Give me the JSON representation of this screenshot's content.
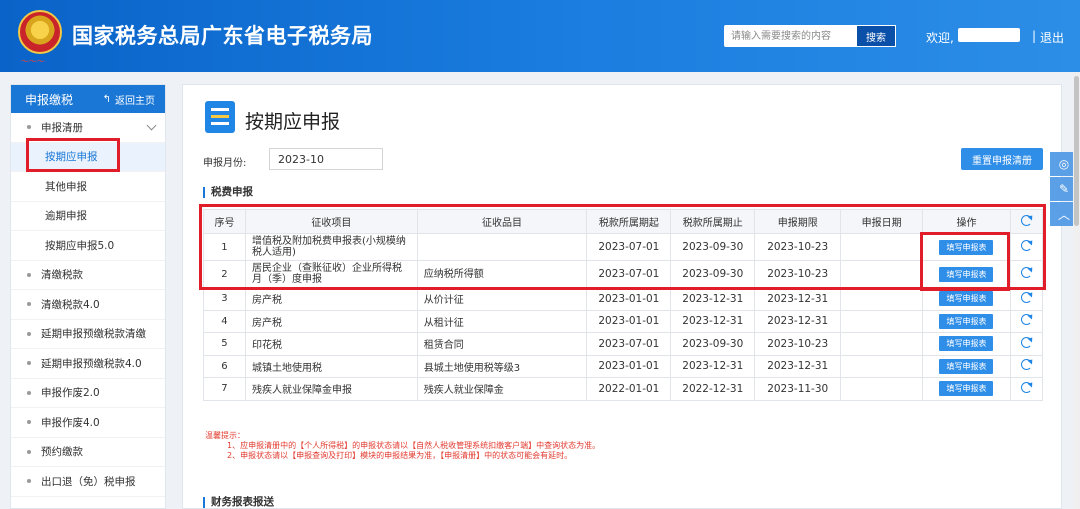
{
  "header": {
    "site_title": "国家税务总局广东省电子税务局",
    "search_placeholder": "请输入需要搜索的内容",
    "search_label": "搜索",
    "welcome": "欢迎,",
    "separator": "|",
    "logout": "退出",
    "brand_color": "#1b7ee0"
  },
  "sidebar": {
    "title": "申报缴税",
    "back_label": "返回主页",
    "items": [
      {
        "label": "申报清册",
        "type": "group"
      },
      {
        "label": "按期应申报",
        "type": "sub",
        "active": true
      },
      {
        "label": "其他申报",
        "type": "sub"
      },
      {
        "label": "逾期申报",
        "type": "sub"
      },
      {
        "label": "按期应申报5.0",
        "type": "sub"
      },
      {
        "label": "清缴税款",
        "type": "item"
      },
      {
        "label": "清缴税款4.0",
        "type": "item"
      },
      {
        "label": "延期申报预缴税款清缴",
        "type": "item"
      },
      {
        "label": "延期申报预缴税款4.0",
        "type": "item"
      },
      {
        "label": "申报作废2.0",
        "type": "item"
      },
      {
        "label": "申报作废4.0",
        "type": "item"
      },
      {
        "label": "预约缴款",
        "type": "item"
      },
      {
        "label": "出口退（免）税申报",
        "type": "item"
      }
    ]
  },
  "main": {
    "page_title": "按期应申报",
    "period_label": "申报月份:",
    "period_value": "2023-10",
    "reset_button": "重置申报清册",
    "section_fees": "税费申报",
    "section_financial": "财务报表报送",
    "table": {
      "headers": [
        "序号",
        "征收项目",
        "征收品目",
        "税款所属期起",
        "税款所属期止",
        "申报期限",
        "申报日期",
        "操作"
      ],
      "action_label": "填写申报表",
      "rows": [
        {
          "no": "1",
          "item": "增值税及附加税费申报表(小规模纳税人适用)",
          "sub": "",
          "start": "2023-07-01",
          "end": "2023-09-30",
          "deadline": "2023-10-23",
          "date": ""
        },
        {
          "no": "2",
          "item": "居民企业（查账征收）企业所得税月（季）度申报",
          "sub": "应纳税所得额",
          "start": "2023-07-01",
          "end": "2023-09-30",
          "deadline": "2023-10-23",
          "date": ""
        },
        {
          "no": "3",
          "item": "房产税",
          "sub": "从价计征",
          "start": "2023-01-01",
          "end": "2023-12-31",
          "deadline": "2023-12-31",
          "date": ""
        },
        {
          "no": "4",
          "item": "房产税",
          "sub": "从租计征",
          "start": "2023-01-01",
          "end": "2023-12-31",
          "deadline": "2023-12-31",
          "date": ""
        },
        {
          "no": "5",
          "item": "印花税",
          "sub": "租赁合同",
          "start": "2023-07-01",
          "end": "2023-09-30",
          "deadline": "2023-10-23",
          "date": ""
        },
        {
          "no": "6",
          "item": "城镇土地使用税",
          "sub": "县城土地使用税等级3",
          "start": "2023-01-01",
          "end": "2023-12-31",
          "deadline": "2023-12-31",
          "date": ""
        },
        {
          "no": "7",
          "item": "残疾人就业保障金申报",
          "sub": "残疾人就业保障金",
          "start": "2022-01-01",
          "end": "2022-12-31",
          "deadline": "2023-11-30",
          "date": ""
        }
      ]
    },
    "tips": {
      "title": "温馨提示：",
      "line1": "1、应申报清册中的【个人所得税】的申报状态请以【自然人税收管理系统扣缴客户端】中查询状态为准。",
      "line2": "2、申报状态请以【申报查询及打印】模块的申报结果为准，【申报清册】中的状态可能会有延时。"
    }
  }
}
